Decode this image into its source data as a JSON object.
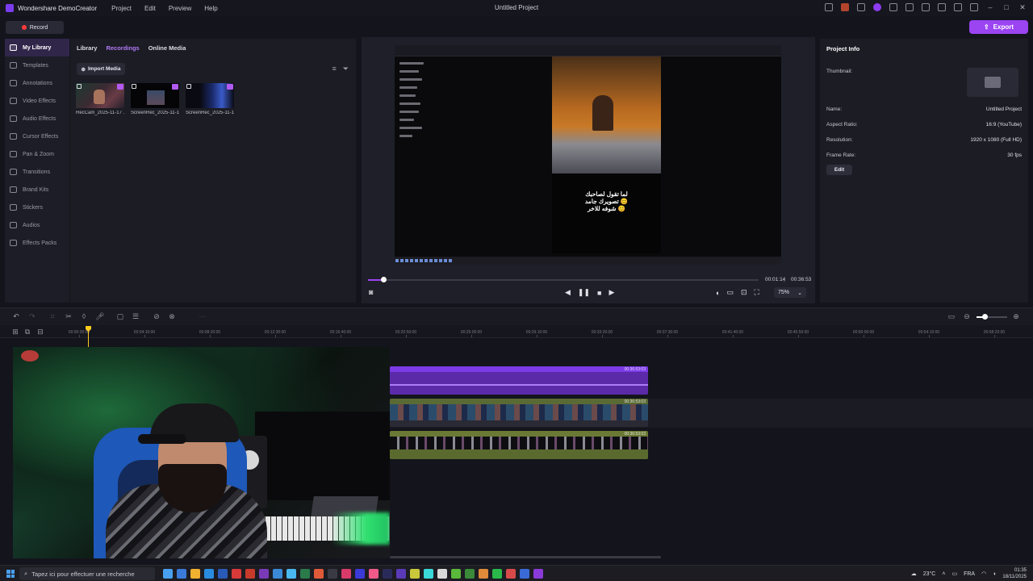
{
  "app": {
    "name": "Wondershare DemoCreator",
    "window_title": "Untitled Project",
    "menu": [
      "Project",
      "Edit",
      "Preview",
      "Help"
    ]
  },
  "toolbar": {
    "record_label": "Record",
    "export_label": "Export"
  },
  "sidebar": {
    "items": [
      {
        "label": "My Library",
        "icon": "library-icon",
        "active": true
      },
      {
        "label": "Templates",
        "icon": "templates-icon"
      },
      {
        "label": "Annotations",
        "icon": "annotations-icon"
      },
      {
        "label": "Video Effects",
        "icon": "video-effects-icon"
      },
      {
        "label": "Audio Effects",
        "icon": "audio-effects-icon"
      },
      {
        "label": "Cursor Effects",
        "icon": "cursor-effects-icon"
      },
      {
        "label": "Pan & Zoom",
        "icon": "pan-zoom-icon"
      },
      {
        "label": "Transitions",
        "icon": "transitions-icon"
      },
      {
        "label": "Brand Kits",
        "icon": "brand-kits-icon"
      },
      {
        "label": "Stickers",
        "icon": "stickers-icon"
      },
      {
        "label": "Audios",
        "icon": "audios-icon"
      },
      {
        "label": "Effects Packs",
        "icon": "effects-packs-icon"
      }
    ]
  },
  "media": {
    "tabs": [
      {
        "label": "Library"
      },
      {
        "label": "Recordings",
        "active": true
      },
      {
        "label": "Online Media"
      }
    ],
    "import_label": "Import Media",
    "items": [
      {
        "name": "RecCam_2025-11-17 ...",
        "kind": "camera"
      },
      {
        "name": "ScreenRec_2025-11-1...",
        "kind": "screen"
      },
      {
        "name": "ScreenRec_2025-11-1...",
        "kind": "screen-blue"
      }
    ]
  },
  "preview": {
    "overlay_text": [
      "لما تقول لصاحبك",
      "تصويرك جامد 😊",
      "شوفه للاخر 😊"
    ],
    "current_time": "00:01:14",
    "separator": "|",
    "total_time": "00:36:53",
    "progress": 0.04,
    "zoom": "75%"
  },
  "project_info": {
    "title": "Project Info",
    "thumbnail_label": "Thumbnail:",
    "fields": [
      {
        "label": "Name:",
        "value": "Untitled Project"
      },
      {
        "label": "Aspect Ratio:",
        "value": "16:9 (YouTube)"
      },
      {
        "label": "Resolution:",
        "value": "1920 x 1080 (Full HD)"
      },
      {
        "label": "Frame Rate:",
        "value": "30 fps"
      }
    ],
    "edit_label": "Edit"
  },
  "timeline": {
    "ruler_ticks": [
      "00:00:00:00",
      "00:04:10:00",
      "00:08:20:00",
      "00:12:30:00",
      "00:16:40:00",
      "00:20:50:00",
      "00:25:00:00",
      "00:29:10:00",
      "00:33:20:00",
      "00:37:30:00",
      "00:41:40:00",
      "00:45:50:00",
      "00:50:00:00",
      "00:54:10:00",
      "00:58:20:00"
    ],
    "clips": [
      {
        "kind": "audio",
        "duration": "00:36:53:03"
      },
      {
        "kind": "camera",
        "duration": "00:36:53:03"
      },
      {
        "kind": "screen",
        "duration": "00:36:53:03"
      }
    ]
  },
  "taskbar": {
    "search_placeholder": "Tapez ici pour effectuer une recherche",
    "weather": "23°C",
    "language": "FRA",
    "time": "01:35",
    "date": "18/11/2025"
  },
  "colors": {
    "accent": "#9a44f2",
    "playhead": "#ffcc20",
    "record": "#ff3a3a",
    "audio_clip": "#7c3ae6",
    "video_clip_header": "#5a6a34"
  }
}
